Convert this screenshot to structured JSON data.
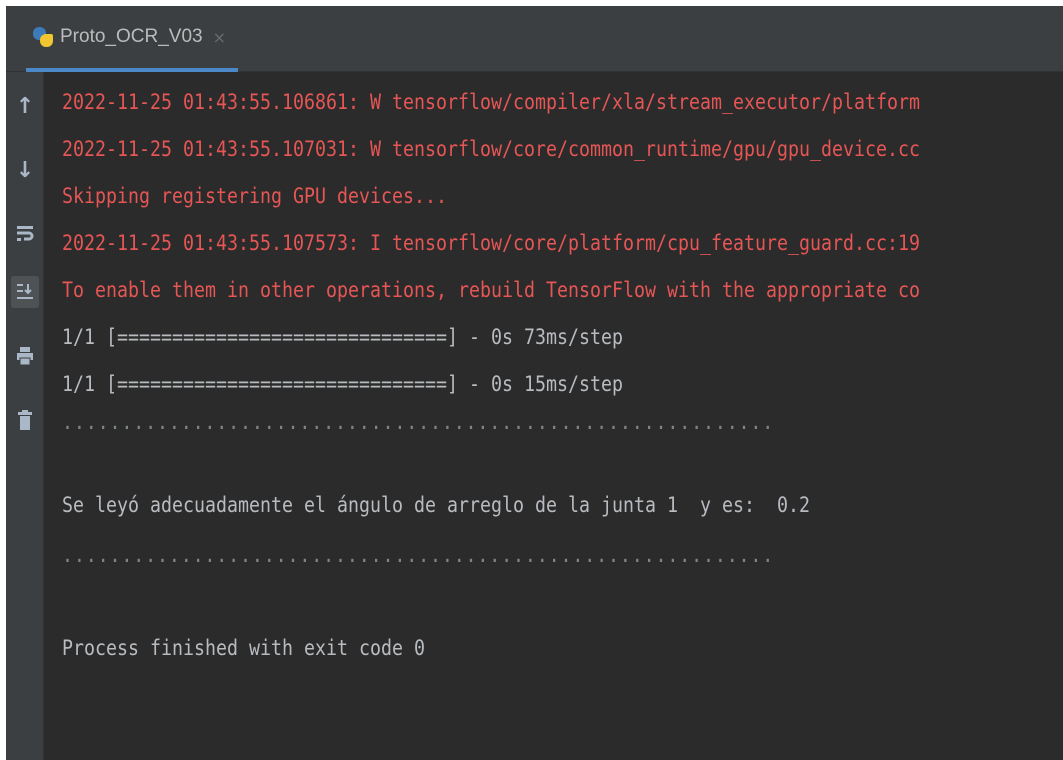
{
  "tab": {
    "title": "Proto_OCR_V03",
    "icon": "python-file-icon",
    "close_glyph": "×"
  },
  "toolbar": {
    "buttons": [
      {
        "name": "up-arrow-icon",
        "glyph": "↑"
      },
      {
        "name": "down-arrow-icon",
        "glyph": "↓"
      },
      {
        "name": "soft-wrap-icon",
        "glyph": "⮐"
      },
      {
        "name": "scroll-to-end-icon",
        "glyph": "⇟"
      },
      {
        "name": "print-icon",
        "glyph": "⎙"
      },
      {
        "name": "trash-icon",
        "glyph": "🗑"
      }
    ]
  },
  "colors": {
    "error_text": "#e55655",
    "output_text": "#b8bcc0",
    "background": "#2b2b2b"
  },
  "console": {
    "lines": [
      "2022-11-25 01:43:55.106861: W tensorflow/compiler/xla/stream_executor/platform",
      "2022-11-25 01:43:55.107031: W tensorflow/core/common_runtime/gpu/gpu_device.cc",
      "Skipping registering GPU devices...",
      "2022-11-25 01:43:55.107573: I tensorflow/core/platform/cpu_feature_guard.cc:19",
      "To enable them in other operations, rebuild TensorFlow with the appropriate co",
      "1/1 [==============================] - 0s 73ms/step",
      "1/1 [==============================] - 0s 15ms/step",
      "............................................................",
      "Se leyó adecuadamente el ángulo de arreglo de la junta 1  y es:  0.2",
      "............................................................",
      "Process finished with exit code 0"
    ]
  }
}
